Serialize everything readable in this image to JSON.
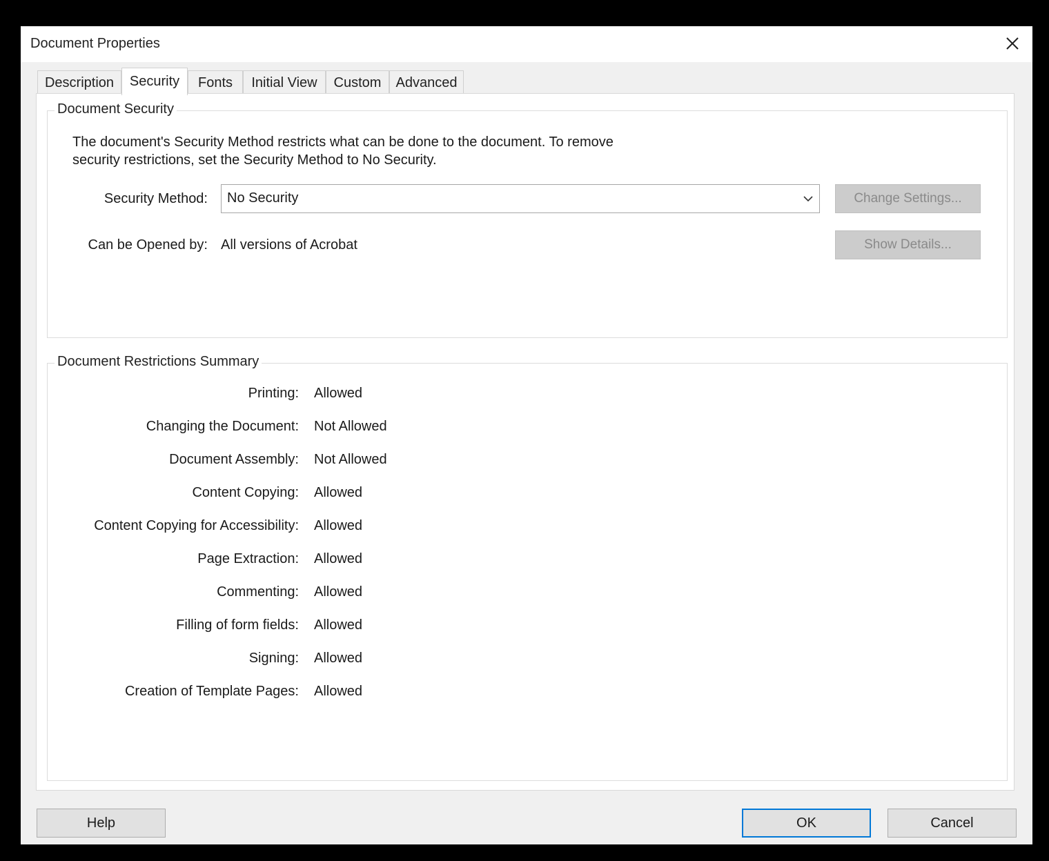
{
  "window": {
    "title": "Document Properties"
  },
  "tabs": [
    {
      "label": "Description"
    },
    {
      "label": "Security"
    },
    {
      "label": "Fonts"
    },
    {
      "label": "Initial View"
    },
    {
      "label": "Custom"
    },
    {
      "label": "Advanced"
    }
  ],
  "active_tab": "Security",
  "security": {
    "group_title": "Document Security",
    "description": "The document's Security Method restricts what can be done to the document. To remove security restrictions, set the Security Method to No Security.",
    "method_label": "Security Method:",
    "method_value": "No Security",
    "change_settings_label": "Change Settings...",
    "opened_by_label": "Can be Opened by:",
    "opened_by_value": "All versions of Acrobat",
    "show_details_label": "Show Details..."
  },
  "restrictions": {
    "group_title": "Document Restrictions Summary",
    "items": [
      {
        "label": "Printing:",
        "value": "Allowed"
      },
      {
        "label": "Changing the Document:",
        "value": "Not Allowed"
      },
      {
        "label": "Document Assembly:",
        "value": "Not Allowed"
      },
      {
        "label": "Content Copying:",
        "value": "Allowed"
      },
      {
        "label": "Content Copying for Accessibility:",
        "value": "Allowed"
      },
      {
        "label": "Page Extraction:",
        "value": "Allowed"
      },
      {
        "label": "Commenting:",
        "value": "Allowed"
      },
      {
        "label": "Filling of form fields:",
        "value": "Allowed"
      },
      {
        "label": "Signing:",
        "value": "Allowed"
      },
      {
        "label": "Creation of Template Pages:",
        "value": "Allowed"
      }
    ]
  },
  "footer": {
    "help_label": "Help",
    "ok_label": "OK",
    "cancel_label": "Cancel"
  },
  "colors": {
    "default_button_border": "#0078d7",
    "disabled_button_bg": "#cccccc",
    "dialog_bg": "#f0f0f0"
  },
  "icons": {
    "close": "close-icon",
    "dropdown": "chevron-down-icon"
  }
}
